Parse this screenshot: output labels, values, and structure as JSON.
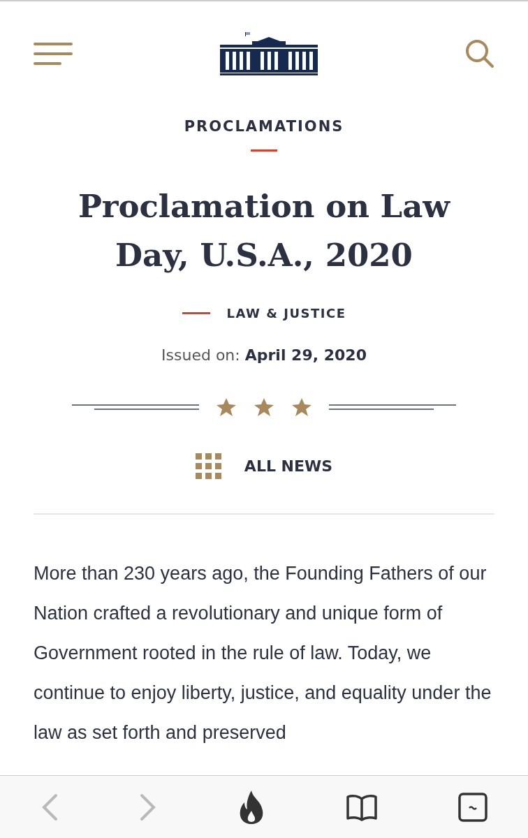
{
  "section": "PROCLAMATIONS",
  "title": "Proclamation on Law Day, U.S.A., 2020",
  "category": "LAW & JUSTICE",
  "issued": {
    "label": "Issued on:",
    "date": "April 29, 2020"
  },
  "all_news": "ALL NEWS",
  "body": "More than 230 years ago, the Founding Fathers of our Nation crafted a revolutionary and unique form of Government rooted in the rule of law. Today, we continue to enjoy liberty, justice, and equality under the law as set forth and preserved",
  "toolbar": [
    {
      "kind": "back",
      "disabled": true
    },
    {
      "kind": "forward",
      "disabled": true
    },
    {
      "kind": "fire",
      "disabled": false
    },
    {
      "kind": "reader",
      "disabled": false
    },
    {
      "kind": "tabs",
      "disabled": false
    }
  ]
}
